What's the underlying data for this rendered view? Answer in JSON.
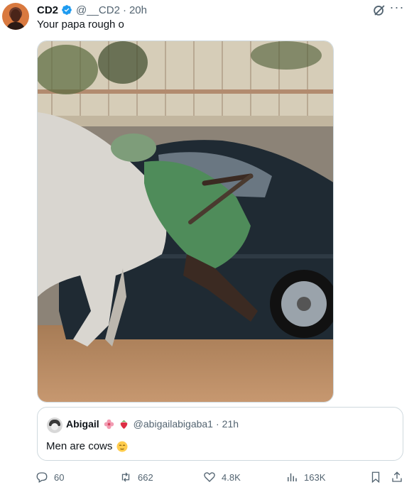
{
  "tweet": {
    "author_name": "CD2",
    "author_handle": "@__CD2",
    "separator": "·",
    "time": "20h",
    "text": "Your papa rough o",
    "verified_color": "#1d9bf0"
  },
  "quote": {
    "author_name": "Abigail",
    "author_handle": "@abigailabigaba1",
    "separator": "·",
    "time": "21h",
    "text": "Men are cows",
    "name_emojis": [
      "hibiscus",
      "strawberry"
    ],
    "text_emoji": "relieved-face"
  },
  "actions": {
    "replies": "60",
    "reposts": "662",
    "likes": "4.8K",
    "views": "163K"
  },
  "menu": {
    "more_label": "···"
  },
  "colors": {
    "muted": "#536471",
    "border": "#cfd9de",
    "text": "#0f1419"
  }
}
